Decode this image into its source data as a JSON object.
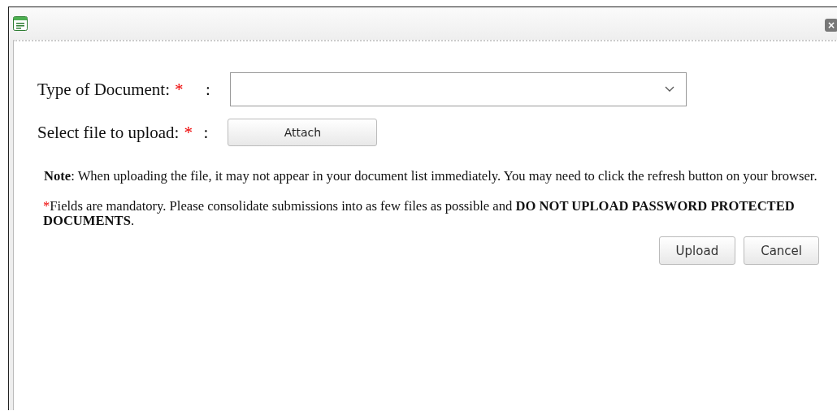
{
  "window": {
    "close": "×"
  },
  "fields": [
    {
      "kind": "select",
      "label": "Type of Document:",
      "required": "*",
      "colon": ":"
    },
    {
      "kind": "file",
      "label": "Select file to upload:",
      "required": "*",
      "colon": ":",
      "button": "Attach"
    }
  ],
  "note": "**Note**: When uploading the file, it may not appear in your document list immediately. You may need to click the refresh button on your browser.",
  "mandatory": {
    "mark": "*",
    "text": "Fields are mandatory. Please consolidate submissions into as few files as possible and **DO NOT UPLOAD PASSWORD PROTECTED DOCUMENTS**."
  },
  "buttons": [
    "Upload",
    "Cancel"
  ]
}
